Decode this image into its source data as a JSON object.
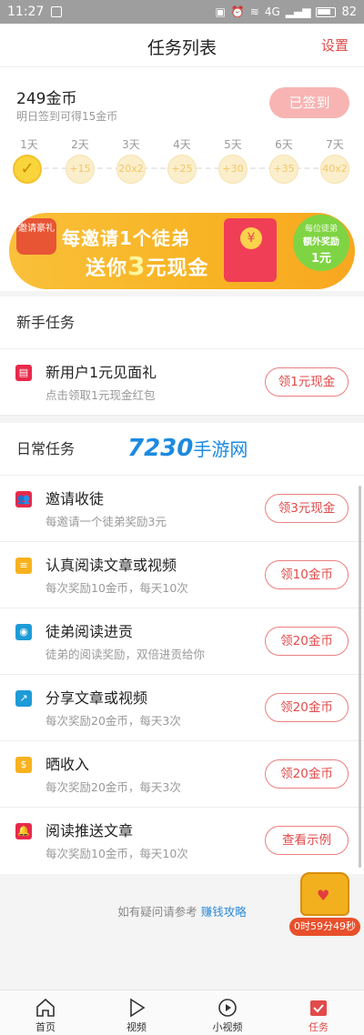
{
  "status_bar": {
    "time": "11:27",
    "battery": "82",
    "network": "4G"
  },
  "header": {
    "title": "任务列表",
    "settings": "设置"
  },
  "signin": {
    "coins": "249金币",
    "subtitle": "明日签到可得15金币",
    "button": "已签到",
    "days": [
      {
        "label": "1天",
        "value": "✓",
        "done": true
      },
      {
        "label": "2天",
        "value": "+15",
        "done": false
      },
      {
        "label": "3天",
        "value": "20x2",
        "done": false
      },
      {
        "label": "4天",
        "value": "+25",
        "done": false
      },
      {
        "label": "5天",
        "value": "+30",
        "done": false
      },
      {
        "label": "6天",
        "value": "+35",
        "done": false
      },
      {
        "label": "7天",
        "value": "40x2",
        "done": false
      }
    ]
  },
  "banner": {
    "tag": "邀请豪礼",
    "line1": "每邀请1个徒弟",
    "line2_prefix": "送你",
    "line2_big": "3",
    "line2_suffix": "元现金",
    "bubble_1": "每位徒弟",
    "bubble_2": "额外奖励",
    "bubble_3": "1元"
  },
  "newbie": {
    "title": "新手任务",
    "tasks": [
      {
        "name": "新用户1元见面礼",
        "desc": "点击领取1元现金红包",
        "button": "领1元现金",
        "icon": "red-envelope-icon",
        "color": "#e8294a"
      }
    ]
  },
  "daily": {
    "title": "日常任务",
    "tasks": [
      {
        "name": "邀请收徒",
        "desc": "每邀请一个徒弟奖励3元",
        "button": "领3元现金",
        "icon": "users-icon",
        "color": "#e8294a"
      },
      {
        "name": "认真阅读文章或视频",
        "desc": "每次奖励10金币，每天10次",
        "button": "领10金币",
        "icon": "document-icon",
        "color": "#f7b21f"
      },
      {
        "name": "徒弟阅读进贡",
        "desc": "徒弟的阅读奖励，双倍进贡给你",
        "button": "领20金币",
        "icon": "eye-icon",
        "color": "#1e9bd7"
      },
      {
        "name": "分享文章或视频",
        "desc": "每次奖励20金币，每天3次",
        "button": "领20金币",
        "icon": "share-icon",
        "color": "#1e9bd7"
      },
      {
        "name": "晒收入",
        "desc": "每次奖励20金币，每天3次",
        "button": "领20金币",
        "icon": "moneybag-icon",
        "color": "#f7b21f"
      },
      {
        "name": "阅读推送文章",
        "desc": "每次奖励10金币，每天10次",
        "button": "查看示例",
        "icon": "bell-icon",
        "color": "#e8294a"
      }
    ]
  },
  "watermark": {
    "num": "7230",
    "text": "手游网"
  },
  "help": {
    "text": "如有疑问请参考",
    "link": "赚钱攻略"
  },
  "chest": {
    "timer": "0时59分49秒"
  },
  "tabs": [
    {
      "label": "首页",
      "icon": "home-icon",
      "active": false
    },
    {
      "label": "视频",
      "icon": "play-icon",
      "active": false
    },
    {
      "label": "小视频",
      "icon": "small-video-icon",
      "active": false
    },
    {
      "label": "任务",
      "icon": "task-icon",
      "active": true
    }
  ]
}
